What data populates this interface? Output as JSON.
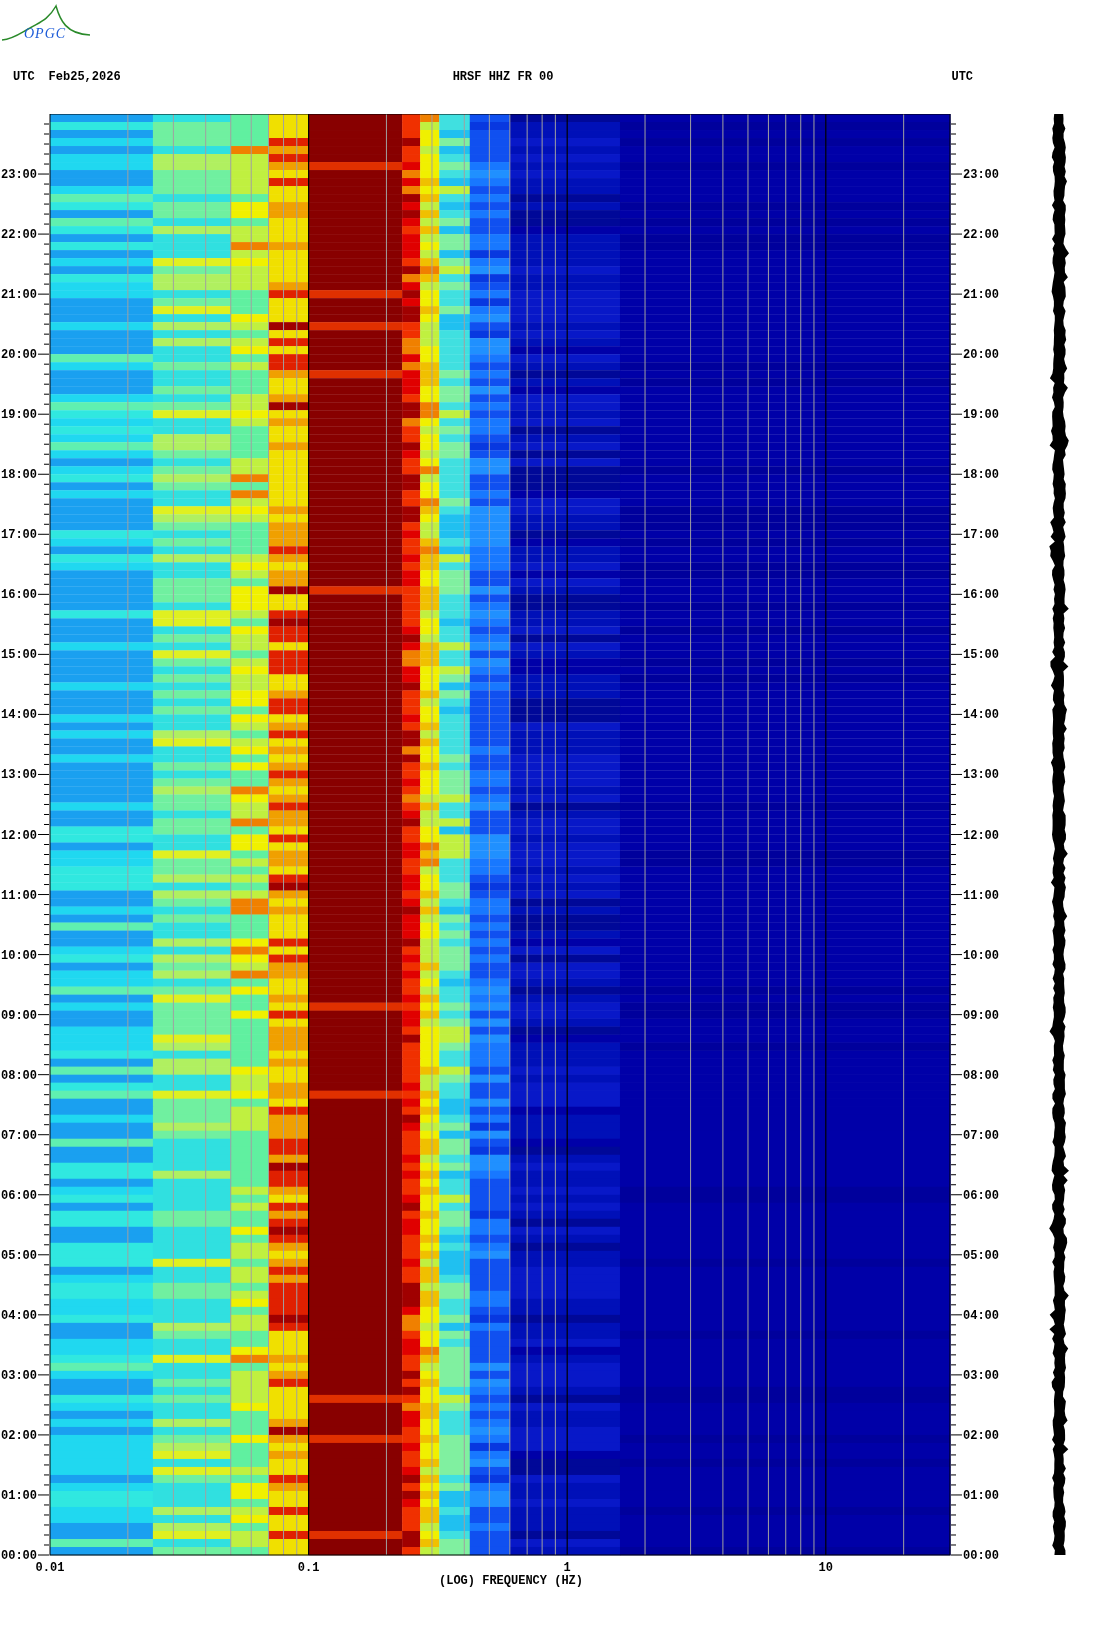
{
  "logo": {
    "text": "OPGC"
  },
  "header": {
    "left_timezone": "UTC",
    "date": "Feb25,2026",
    "station": "HRSF HHZ FR 00",
    "right_timezone": "UTC"
  },
  "time_axis_left": [
    "23:00",
    "22:00",
    "21:00",
    "20:00",
    "19:00",
    "18:00",
    "17:00",
    "16:00",
    "15:00",
    "14:00",
    "13:00",
    "12:00",
    "11:00",
    "10:00",
    "09:00",
    "08:00",
    "07:00",
    "06:00",
    "05:00",
    "04:00",
    "03:00",
    "02:00",
    "01:00",
    "00:00"
  ],
  "time_axis_right": [
    "23:00",
    "22:00",
    "21:00",
    "20:00",
    "19:00",
    "18:00",
    "17:00",
    "16:00",
    "15:00",
    "14:00",
    "13:00",
    "12:00",
    "11:00",
    "10:00",
    "09:00",
    "08:00",
    "07:00",
    "06:00",
    "05:00",
    "04:00",
    "03:00",
    "02:00",
    "01:00",
    "00:00"
  ],
  "frequency_axis": {
    "ticks": [
      "0.01",
      "0.1",
      "1",
      "10"
    ],
    "label": "(LOG) FREQUENCY (HZ)"
  }
}
